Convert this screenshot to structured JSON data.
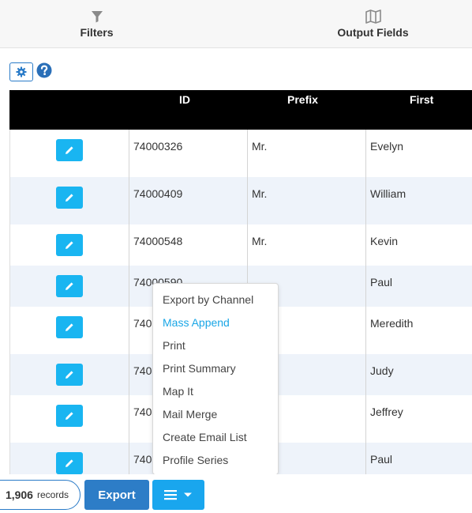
{
  "tabs": [
    {
      "label": "Filters",
      "icon": "filter-icon"
    },
    {
      "label": "Output Fields",
      "icon": "map-icon"
    }
  ],
  "toolbar": {
    "settings_icon": "gear-icon",
    "help_icon": "help-icon"
  },
  "table": {
    "headers": {
      "id": "ID",
      "prefix": "Prefix",
      "first": "First"
    },
    "rows": [
      {
        "id": "74000326",
        "prefix": "Mr.",
        "first": "Evelyn"
      },
      {
        "id": "74000409",
        "prefix": "Mr.",
        "first": "William"
      },
      {
        "id": "74000548",
        "prefix": "Mr.",
        "first": "Kevin"
      },
      {
        "id": "74000590",
        "prefix": "",
        "first": "Paul"
      },
      {
        "id": "740",
        "prefix": "",
        "first": "Meredith"
      },
      {
        "id": "740",
        "prefix": "",
        "first": "Judy"
      },
      {
        "id": "740",
        "prefix": "",
        "first": "Jeffrey"
      },
      {
        "id": "740",
        "prefix": "",
        "first": "Paul"
      }
    ]
  },
  "menu": {
    "items": [
      "Export by Channel",
      "Mass Append",
      "Print",
      "Print Summary",
      "Map It",
      "Mail Merge",
      "Create Email List",
      "Profile Series"
    ],
    "active_color": "#19a6e6"
  },
  "footer": {
    "records_count": "1,906",
    "records_label": "records",
    "export_label": "Export",
    "menu_icon": "hamburger-icon"
  },
  "colors": {
    "accent": "#19b5f1",
    "export": "#2d7dc7",
    "header_bg": "#000000",
    "alt_row": "#eef3fa"
  }
}
